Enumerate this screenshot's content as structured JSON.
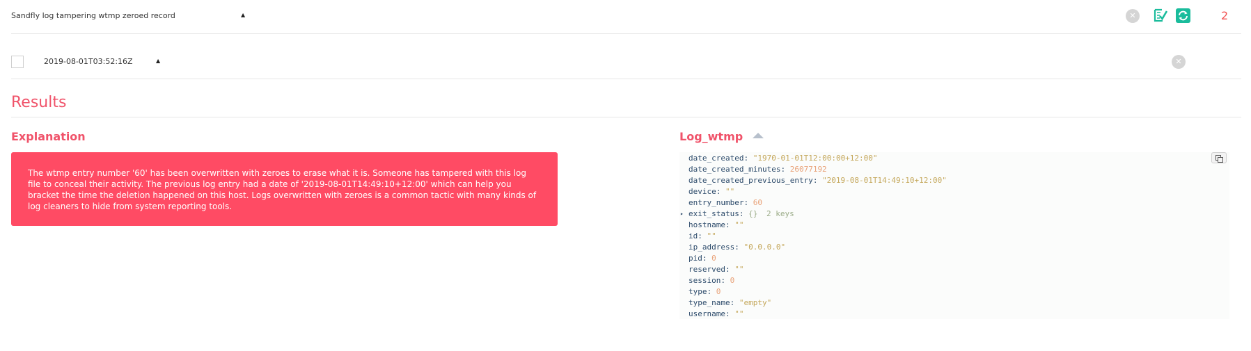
{
  "alert_row": {
    "title": "Sandfly log tampering wtmp zeroed record",
    "caret": "▲",
    "count": "2",
    "icons": [
      "close-circle-icon",
      "checklist-icon",
      "sync-icon"
    ],
    "colors": {
      "accent_green": "#1abc9c",
      "count_red": "#f15050"
    }
  },
  "entry_row": {
    "date": "2019-08-01T03:52:16Z",
    "caret": "▲"
  },
  "results": {
    "heading": "Results",
    "explanation": {
      "heading": "Explanation",
      "text": "The wtmp entry number '60' has been overwritten with zeroes to erase what it is. Someone has tampered with this log file to conceal their activity. The previous log entry had a date of '2019-08-01T14:49:10+12:00' which can help you bracket the time the deletion happened on this host. Logs overwritten with zeroes is a common tactic with many kinds of log cleaners to hide from system reporting tools.",
      "box_color": "#ff4b64"
    },
    "log": {
      "heading": "Log_wtmp",
      "fields": [
        {
          "key": "date_created",
          "value": "\"1970-01-01T12:00:00+12:00\"",
          "kind": "str"
        },
        {
          "key": "date_created_minutes",
          "value": "26077192",
          "kind": "num"
        },
        {
          "key": "date_created_previous_entry",
          "value": "\"2019-08-01T14:49:10+12:00\"",
          "kind": "str"
        },
        {
          "key": "device",
          "value": "\"\"",
          "kind": "str"
        },
        {
          "key": "entry_number",
          "value": "60",
          "kind": "num"
        },
        {
          "key": "exit_status",
          "value": "{}",
          "meta": "2 keys",
          "kind": "obj"
        },
        {
          "key": "hostname",
          "value": "\"\"",
          "kind": "str"
        },
        {
          "key": "id",
          "value": "\"\"",
          "kind": "str"
        },
        {
          "key": "ip_address",
          "value": "\"0.0.0.0\"",
          "kind": "str"
        },
        {
          "key": "pid",
          "value": "0",
          "kind": "num"
        },
        {
          "key": "reserved",
          "value": "\"\"",
          "kind": "str"
        },
        {
          "key": "session",
          "value": "0",
          "kind": "num"
        },
        {
          "key": "type",
          "value": "0",
          "kind": "num"
        },
        {
          "key": "type_name",
          "value": "\"empty\"",
          "kind": "str"
        },
        {
          "key": "username",
          "value": "\"\"",
          "kind": "str"
        }
      ]
    }
  }
}
